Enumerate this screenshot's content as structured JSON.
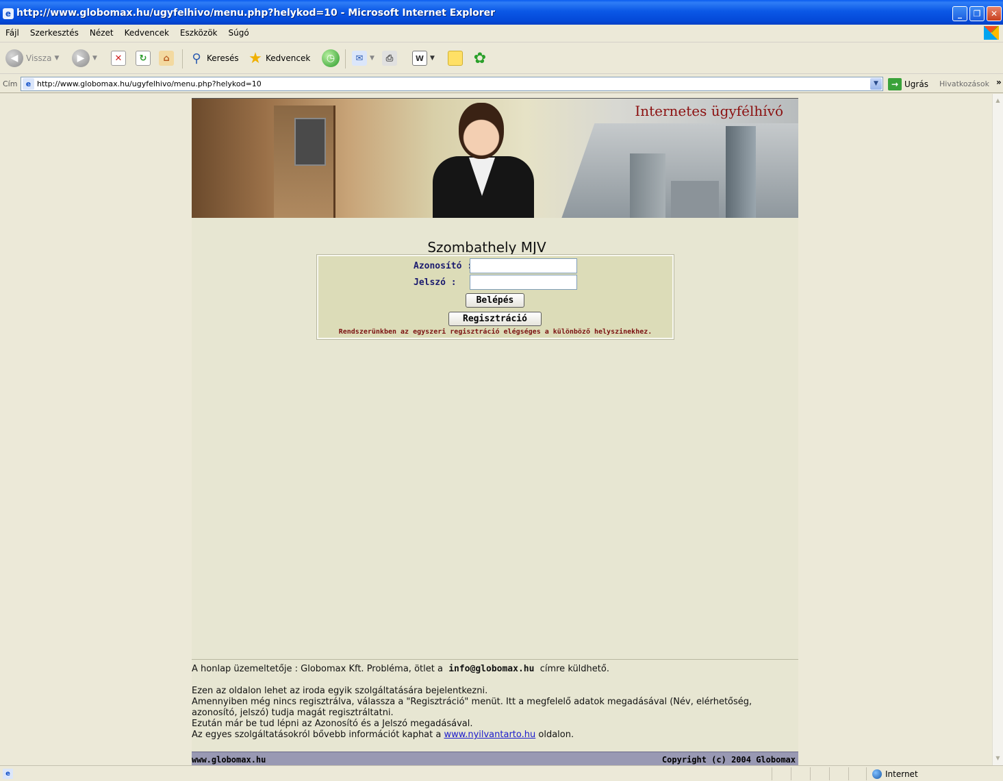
{
  "window": {
    "title": "http://www.globomax.hu/ugyfelhivo/menu.php?helykod=10 - Microsoft Internet Explorer",
    "buttons": {
      "minimize": "_",
      "maximize": "❐",
      "close": "✕"
    }
  },
  "menu": {
    "items": [
      "Fájl",
      "Szerkesztés",
      "Nézet",
      "Kedvencek",
      "Eszközök",
      "Súgó"
    ]
  },
  "toolbar": {
    "back_label": "Vissza",
    "search_label": "Keresés",
    "favorites_label": "Kedvencek"
  },
  "address": {
    "label": "Cím",
    "url": "http://www.globomax.hu/ugyfelhivo/menu.php?helykod=10",
    "go_label": "Ugrás",
    "links_label": "Hivatkozások"
  },
  "page": {
    "banner_title": "Internetes ügyfélhívó",
    "heading": "Szombathely MJV",
    "login": {
      "username_label": "Azonosító :",
      "username_value": "",
      "password_label": "Jelszó :",
      "password_value": "",
      "login_button": "Belépés",
      "register_button": "Regisztráció",
      "note": "Rendszerünkben az egyszeri regisztráció elégséges a különböző helyszinekhez."
    },
    "footer": {
      "operator_text": "A honlap üzemeltetője : Globomax Kft. Probléma, ötlet a",
      "email": "info@globomax.hu",
      "operator_suffix": "címre küldhető.",
      "desc_lines": [
        "Ezen az oldalon lehet az iroda egyik szolgáltatására bejelentkezni.",
        "Amennyiben még nincs regisztrálva, válassza a \"Regisztráció\" menüt. Itt a megfelelő adatok megadásával (Név, elérhetőség, azonosító, jelszó) tudja magát regisztráltatni.",
        "Ezután már be tud lépni az Azonosító és a Jelszó megadásával."
      ],
      "last_line_prefix": "Az egyes szolgáltatásokról bővebb információt kaphat a",
      "link_text": "www.nyilvantarto.hu",
      "last_line_suffix": "oldalon.",
      "bar_left": "www.globomax.hu",
      "bar_right": "Copyright (c) 2004 Globomax"
    }
  },
  "statusbar": {
    "zone": "Internet"
  }
}
